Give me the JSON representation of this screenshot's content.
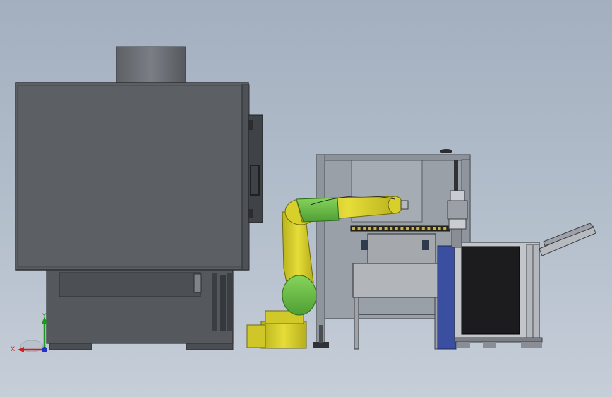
{
  "view": {
    "background_top": "#a3afbf",
    "background_bottom": "#c6ced8"
  },
  "triad": {
    "x_label": "X",
    "y_label": "Y",
    "x_color": "#cc1f1f",
    "y_color": "#1a9a1a",
    "z_color": "#2233cc"
  },
  "components": {
    "machine_body_color": "#5c5f63",
    "machine_base_color": "#4e5156",
    "chimney_color": "#6e7277",
    "robot_yellow": "#d8d02a",
    "robot_green": "#6fc24a",
    "frame_color": "#9aa0a8",
    "conveyor_blue": "#3a4fa0",
    "bin_color": "#1c1c1e",
    "table_color": "#b2b6bb"
  }
}
